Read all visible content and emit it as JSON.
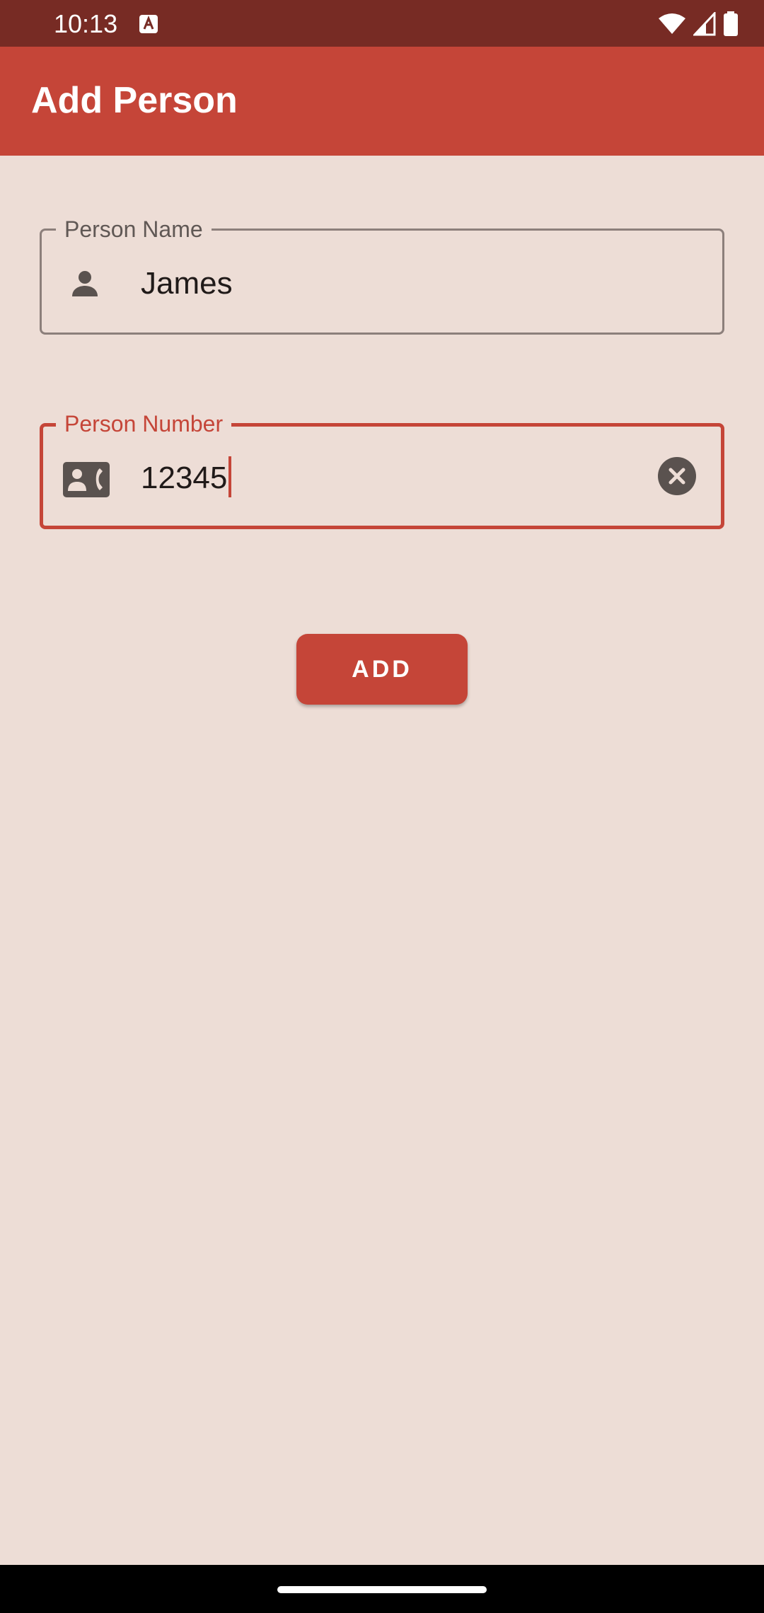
{
  "status_bar": {
    "time": "10:13",
    "icons": [
      "keyboard-a-icon",
      "wifi-icon",
      "signal-icon",
      "battery-icon"
    ]
  },
  "app_bar": {
    "title": "Add Person"
  },
  "form": {
    "name_field": {
      "label": "Person Name",
      "value": "James",
      "icon": "person-icon"
    },
    "number_field": {
      "label": "Person Number",
      "value": "12345",
      "icon": "contact-phone-icon",
      "trailing_icon": "clear-icon",
      "focused": true
    },
    "add_button_label": "ADD"
  },
  "colors": {
    "primary": "#C54538",
    "status_bar": "#772B24",
    "background": "#EDDDD6",
    "icon": "#5a524f"
  }
}
